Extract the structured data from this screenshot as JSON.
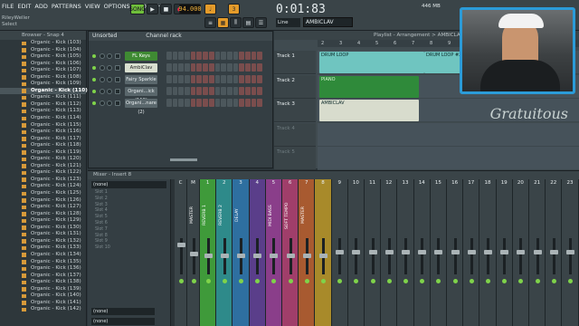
{
  "menu": [
    "FILE",
    "EDIT",
    "ADD",
    "PATTERNS",
    "VIEW",
    "OPTIONS",
    "TOOLS",
    "HELP"
  ],
  "hint": {
    "line1": "RileyWeller",
    "line2": "Select"
  },
  "transport": {
    "mode": "SONG",
    "tempo": "94.000",
    "time": "0:01:83",
    "pattern": "AMBICLAV",
    "cpu": "446 MB",
    "line_mode": "Line"
  },
  "browser": {
    "header": "Browser - Snap 4",
    "items": [
      "Organic - Kick (103)",
      "Organic - Kick (104)",
      "Organic - Kick (105)",
      "Organic - Kick (106)",
      "Organic - Kick (107)",
      "Organic - Kick (108)",
      "Organic - Kick (109)",
      "Organic - Kick (110)",
      "Organic - Kick (111)",
      "Organic - Kick (112)",
      "Organic - Kick (113)",
      "Organic - Kick (114)",
      "Organic - Kick (115)",
      "Organic - Kick (116)",
      "Organic - Kick (117)",
      "Organic - Kick (118)",
      "Organic - Kick (119)",
      "Organic - Kick (120)",
      "Organic - Kick (121)",
      "Organic - Kick (122)",
      "Organic - Kick (123)",
      "Organic - Kick (124)",
      "Organic - Kick (125)",
      "Organic - Kick (126)",
      "Organic - Kick (127)",
      "Organic - Kick (128)",
      "Organic - Kick (129)",
      "Organic - Kick (130)",
      "Organic - Kick (131)",
      "Organic - Kick (132)",
      "Organic - Kick (133)",
      "Organic - Kick (134)",
      "Organic - Kick (135)",
      "Organic - Kick (136)",
      "Organic - Kick (137)",
      "Organic - Kick (138)",
      "Organic - Kick (139)",
      "Organic - Kick (140)",
      "Organic - Kick (141)",
      "Organic - Kick (142)"
    ],
    "selected_index": 7
  },
  "channel_rack": {
    "title": "Channel rack",
    "filter": "Unsorted",
    "channels": [
      {
        "name": "FL Keys",
        "style": "active"
      },
      {
        "name": "AmbiClav",
        "style": "selected"
      },
      {
        "name": "Fairy Sparkle",
        "style": "normal"
      },
      {
        "name": "Organi...ick (110)",
        "style": "normal"
      },
      {
        "name": "Organi...nare (2)",
        "style": "normal"
      }
    ]
  },
  "playlist": {
    "title": "Playlist - Arrangement > AMBICLAV",
    "ruler": [
      "2",
      "3",
      "4",
      "5",
      "6",
      "7",
      "8",
      "9",
      "10",
      "11",
      "12",
      "13",
      "14",
      "15"
    ],
    "tracks": [
      {
        "label": "Track 1",
        "clips": [
          "DRUM LOOP",
          "DRUM LOOP #2"
        ]
      },
      {
        "label": "Track 2",
        "clips": [
          "PIANO"
        ]
      },
      {
        "label": "Track 3",
        "clips": [
          "AMBICLAV"
        ]
      },
      {
        "label": "Track 4",
        "clips": []
      },
      {
        "label": "Track 5",
        "clips": []
      }
    ],
    "brand": "Gratuitous"
  },
  "mixer": {
    "title": "Mixer - Insert 8",
    "insert_slots": [
      "Slot 1",
      "Slot 2",
      "Slot 3",
      "Slot 4",
      "Slot 5",
      "Slot 6",
      "Slot 7",
      "Slot 8",
      "Slot 9",
      "Slot 10"
    ],
    "input": "(none)",
    "output_a": "(none)",
    "output_b": "(none)",
    "strips": [
      {
        "num": "C",
        "name": "",
        "color": "#3a4448"
      },
      {
        "num": "M",
        "name": "MASTER",
        "color": "#3a4448"
      },
      {
        "num": "1",
        "name": "REVERB 1",
        "color": "#3f9a3a"
      },
      {
        "num": "2",
        "name": "REVERB 2",
        "color": "#2e8a8a"
      },
      {
        "num": "3",
        "name": "DELAY",
        "color": "#2e6fa0"
      },
      {
        "num": "4",
        "name": "",
        "color": "#5a3e8a"
      },
      {
        "num": "5",
        "name": "MIDI BASS",
        "color": "#8a3e8a"
      },
      {
        "num": "6",
        "name": "SOFT TEMPO",
        "color": "#a03e6a"
      },
      {
        "num": "7",
        "name": "MASTER",
        "color": "#a85a30"
      },
      {
        "num": "8",
        "name": "",
        "color": "#a88a2a"
      },
      {
        "num": "9",
        "name": "",
        "color": "#3a4448"
      },
      {
        "num": "10",
        "name": "",
        "color": "#3a4448"
      },
      {
        "num": "11",
        "name": "",
        "color": "#3a4448"
      },
      {
        "num": "12",
        "name": "",
        "color": "#3a4448"
      },
      {
        "num": "13",
        "name": "",
        "color": "#3a4448"
      },
      {
        "num": "14",
        "name": "",
        "color": "#3a4448"
      },
      {
        "num": "15",
        "name": "",
        "color": "#3a4448"
      },
      {
        "num": "16",
        "name": "",
        "color": "#3a4448"
      },
      {
        "num": "17",
        "name": "",
        "color": "#3a4448"
      },
      {
        "num": "18",
        "name": "",
        "color": "#3a4448"
      },
      {
        "num": "19",
        "name": "",
        "color": "#3a4448"
      },
      {
        "num": "20",
        "name": "",
        "color": "#3a4448"
      },
      {
        "num": "21",
        "name": "",
        "color": "#3a4448"
      },
      {
        "num": "22",
        "name": "",
        "color": "#3a4448"
      },
      {
        "num": "23",
        "name": "",
        "color": "#3a4448"
      }
    ]
  }
}
